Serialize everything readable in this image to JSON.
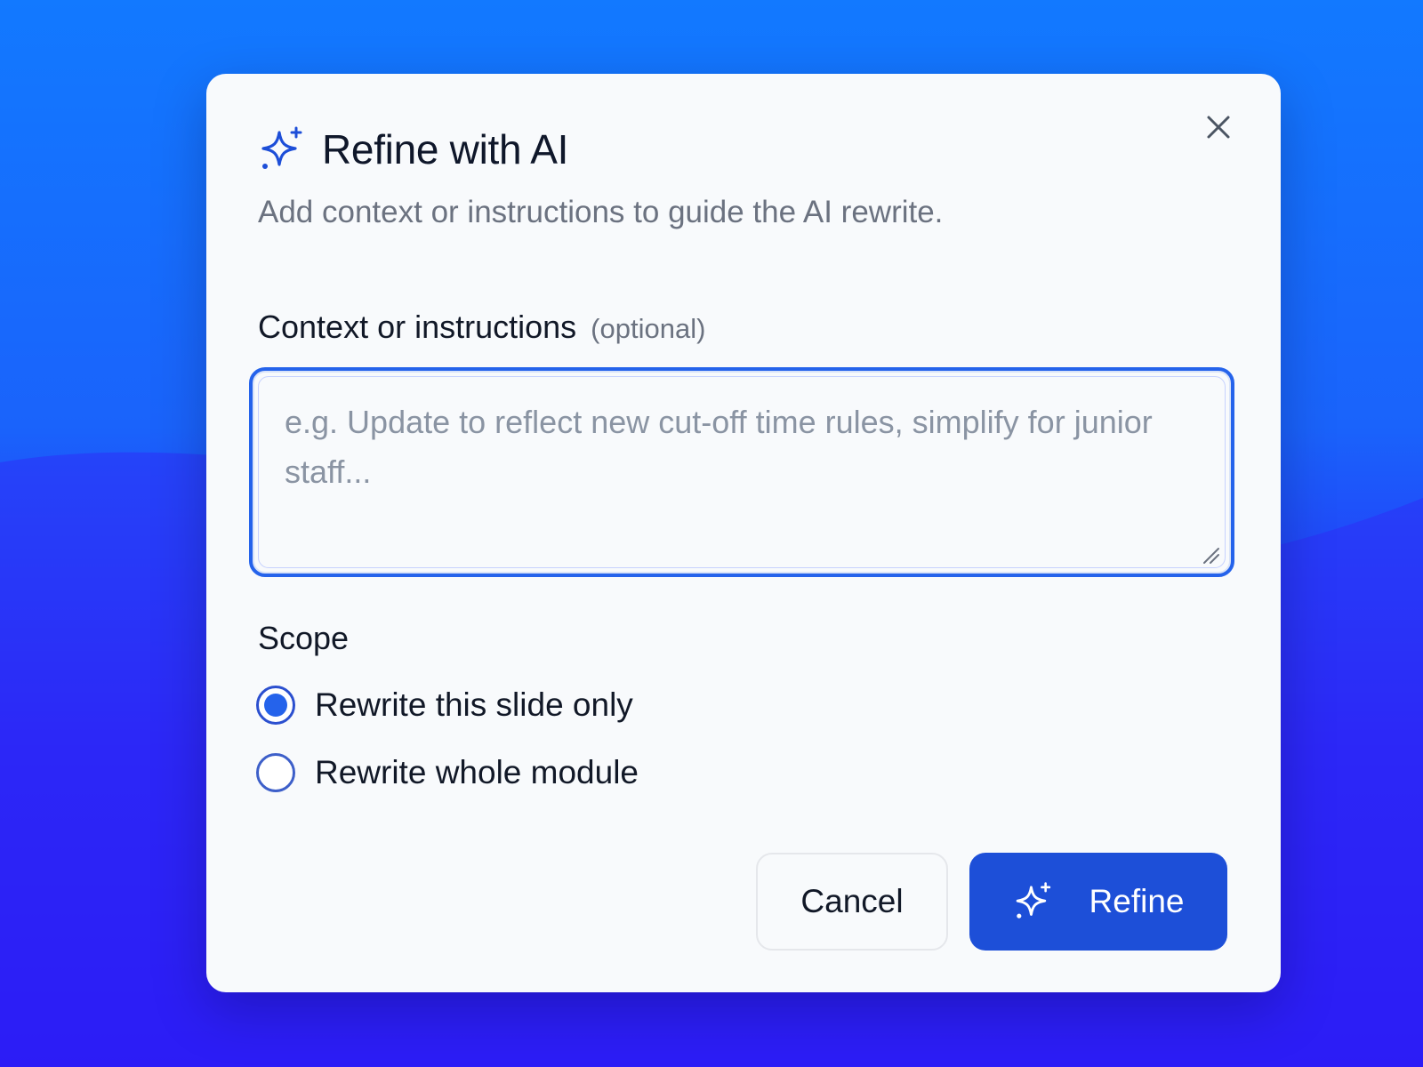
{
  "dialog": {
    "title": "Refine with AI",
    "subtitle": "Add context or instructions to guide the AI rewrite.",
    "title_icon": "sparkles-icon",
    "close_icon": "close-icon"
  },
  "field": {
    "label": "Context or instructions",
    "optional": "(optional)",
    "value": "",
    "placeholder": "e.g. Update to reflect new cut-off time rules, simplify for junior staff..."
  },
  "scope": {
    "label": "Scope",
    "options": [
      {
        "label": "Rewrite this slide only",
        "selected": true
      },
      {
        "label": "Rewrite whole module",
        "selected": false
      }
    ]
  },
  "actions": {
    "cancel_label": "Cancel",
    "refine_label": "Refine",
    "refine_icon": "sparkles-icon"
  },
  "colors": {
    "accent": "#2563eb",
    "primary_button": "#1d4fd8",
    "background_top": "#1279ff",
    "background_bottom": "#2a06f3"
  }
}
